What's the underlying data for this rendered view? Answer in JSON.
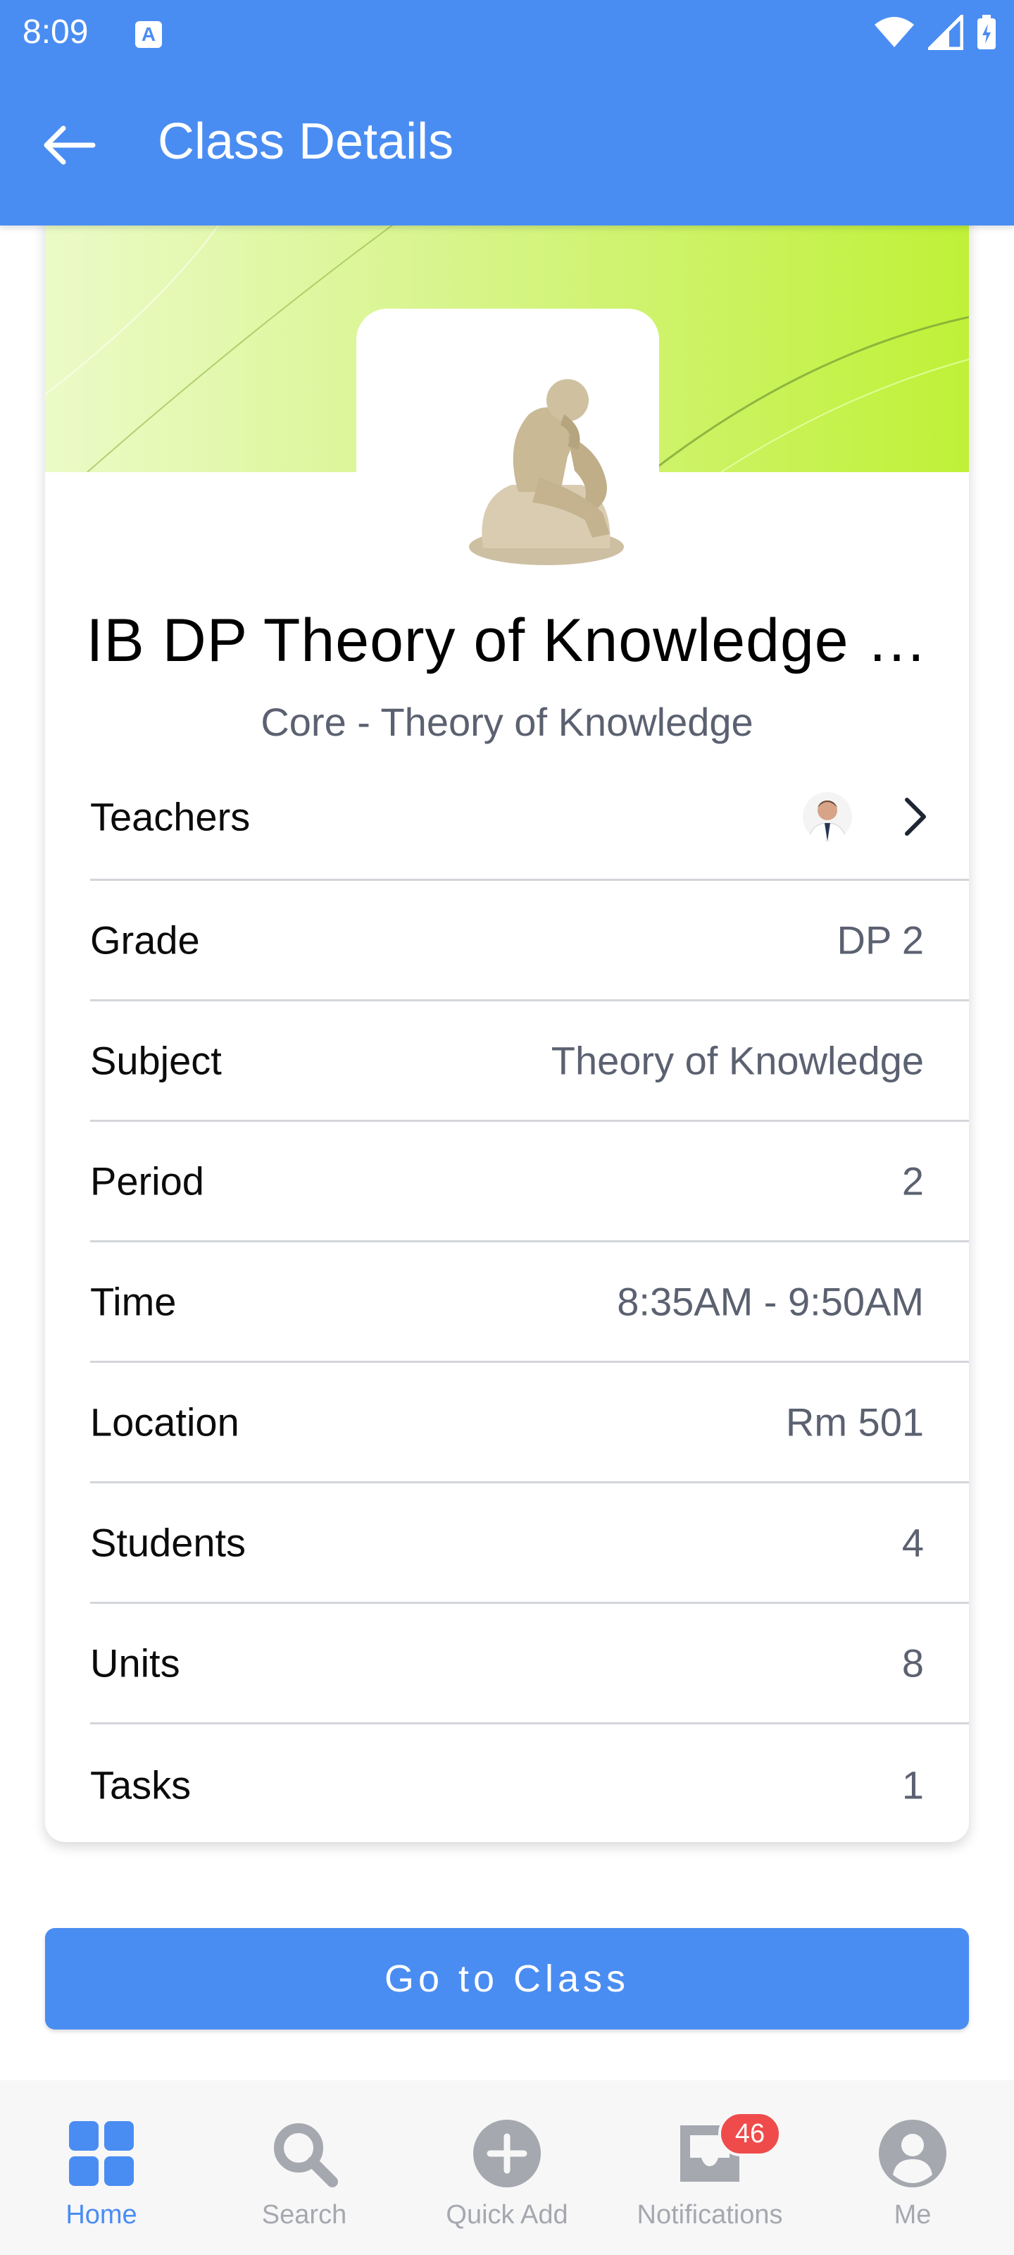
{
  "status_bar": {
    "time": "8:09",
    "notification_glyph": "A"
  },
  "app_bar": {
    "title": "Class Details"
  },
  "class": {
    "title": "IB DP Theory of Knowledge …",
    "subtitle": "Core - Theory of Knowledge"
  },
  "details": {
    "teachers_label": "Teachers",
    "rows": [
      {
        "label": "Grade",
        "value": "DP 2"
      },
      {
        "label": "Subject",
        "value": "Theory of Knowledge"
      },
      {
        "label": "Period",
        "value": "2"
      },
      {
        "label": "Time",
        "value": "8:35AM - 9:50AM"
      },
      {
        "label": "Location",
        "value": "Rm 501"
      },
      {
        "label": "Students",
        "value": "4"
      },
      {
        "label": "Units",
        "value": "8"
      },
      {
        "label": "Tasks",
        "value": "1"
      }
    ]
  },
  "actions": {
    "go_to_class": "Go to Class"
  },
  "bottom_nav": {
    "items": [
      {
        "label": "Home",
        "icon": "grid-icon",
        "active": true
      },
      {
        "label": "Search",
        "icon": "search-icon"
      },
      {
        "label": "Quick Add",
        "icon": "plus-circle-icon"
      },
      {
        "label": "Notifications",
        "icon": "inbox-icon",
        "badge": "46"
      },
      {
        "label": "Me",
        "icon": "person-icon"
      }
    ]
  },
  "colors": {
    "primary": "#4a8df2",
    "badge": "#ef4b4b",
    "banner_start": "#ebfbc7",
    "banner_end": "#c0f137"
  }
}
